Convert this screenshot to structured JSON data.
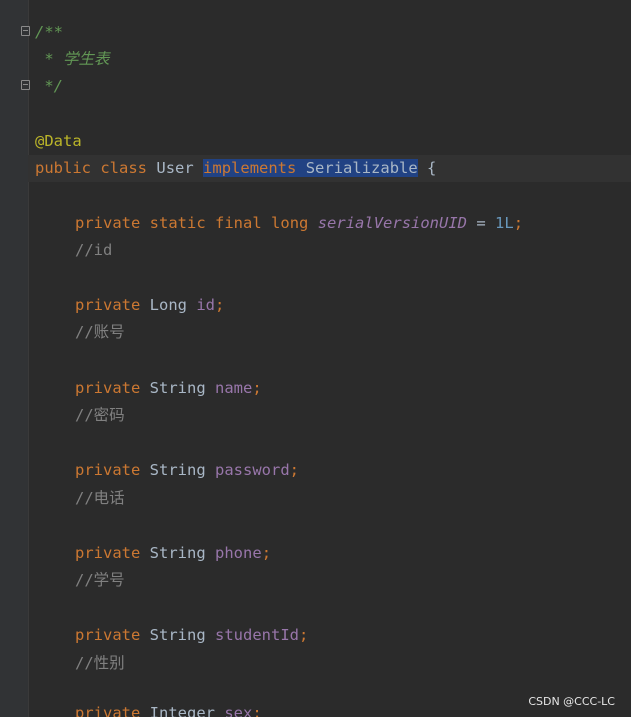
{
  "editor": {
    "doc_open": "/**",
    "doc_text": " * 学生表",
    "doc_close": " */",
    "annotation": "@Data",
    "class_decl": {
      "kw_public": "public",
      "kw_class": "class",
      "class_name": "User",
      "kw_implements": "implements",
      "iface": "Serializable",
      "brace": "{"
    },
    "serial": {
      "kw_private": "private",
      "kw_static": "static",
      "kw_final": "final",
      "kw_long": "long",
      "name": "serialVersionUID",
      "eq": "=",
      "value": "1L",
      "semi": ";"
    },
    "fields": [
      {
        "comment": "//id",
        "kw": "private",
        "type": "Long",
        "name": "id",
        "semi": ";"
      },
      {
        "comment": "//账号",
        "kw": "private",
        "type": "String",
        "name": "name",
        "semi": ";"
      },
      {
        "comment": "//密码",
        "kw": "private",
        "type": "String",
        "name": "password",
        "semi": ";"
      },
      {
        "comment": "//电话",
        "kw": "private",
        "type": "String",
        "name": "phone",
        "semi": ";"
      },
      {
        "comment": "//学号",
        "kw": "private",
        "type": "String",
        "name": "studentId",
        "semi": ";"
      },
      {
        "comment": "//性别",
        "kw": "private",
        "type": "Integer",
        "name": "sex",
        "semi": ";"
      }
    ]
  },
  "watermark": "CSDN @CCC-LC"
}
